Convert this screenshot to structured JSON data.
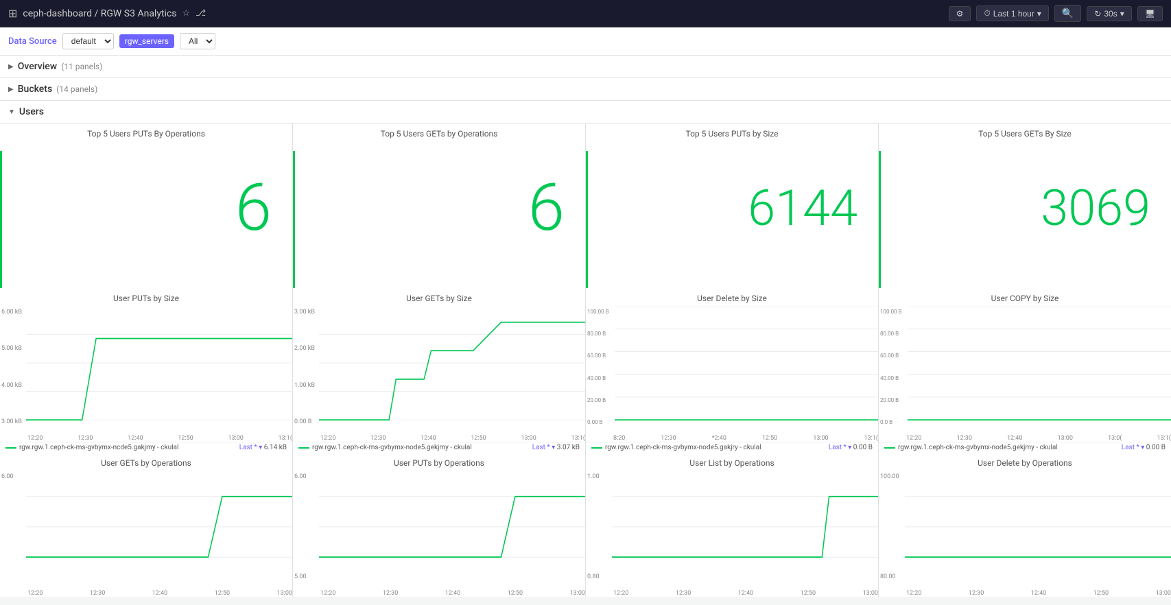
{
  "topbar": {
    "breadcrumb": "ceph-dashboard / RGW S3 Analytics",
    "settings_icon": "⚙",
    "clock_icon": "⏱",
    "time_range": "Last 1 hour",
    "zoom_icon": "🔍",
    "refresh_rate": "30s",
    "monitor_icon": "🖥"
  },
  "filterbar": {
    "label": "Data Source",
    "datasource_value": "default",
    "server_badge": "rgw_servers",
    "filter_value": "All"
  },
  "sections": [
    {
      "id": "overview",
      "label": "Overview",
      "count": "11 panels",
      "collapsed": true
    },
    {
      "id": "buckets",
      "label": "Buckets",
      "count": "14 panels",
      "collapsed": true
    },
    {
      "id": "users",
      "label": "Users",
      "collapsed": false
    }
  ],
  "stat_panels": [
    {
      "id": "top5-puts-ops",
      "title": "Top 5 Users PUTs By Operations",
      "value": "6"
    },
    {
      "id": "top5-gets-ops",
      "title": "Top 5 Users GETs by Operations",
      "value": "6"
    },
    {
      "id": "top5-puts-size",
      "title": "Top 5 Users PUTs by Size",
      "value": "6144"
    },
    {
      "id": "top5-gets-size",
      "title": "Top 5 Users GETs By Size",
      "value": "3069"
    }
  ],
  "chart_panels": [
    {
      "id": "user-puts-size",
      "title": "User PUTs by Size",
      "y_labels": [
        "6.00 kB",
        "5.00 kB",
        "4.00 kB",
        "3.00 kB"
      ],
      "x_labels": [
        "12:20",
        "12:30",
        "12:40",
        "12:50",
        "13:00",
        "13:1("
      ],
      "legend_text": "rgw.rgw.1.ceph-ck-ms-gvbymx-ncde5.gakjmy - ckulal",
      "legend_value": "6.14 kB",
      "last_label": "Last *"
    },
    {
      "id": "user-gets-size",
      "title": "User GETs by Size",
      "y_labels": [
        "3.00 kB",
        "2.00 kB",
        "1.00 kB",
        "0.00 B"
      ],
      "x_labels": [
        "12:20",
        "12:30",
        "12:40",
        "12:50",
        "13:00",
        "13:1("
      ],
      "legend_text": "rgw.rgw.1.ceph-ck-ms-gvbymx-node5.gekjmy - ckulal",
      "legend_value": "3.07 kB",
      "last_label": "Last *"
    },
    {
      "id": "user-delete-size",
      "title": "User Delete by Size",
      "y_labels": [
        "100.00 B",
        "80.00 B",
        "60.00 B",
        "40.00 B",
        "20.00 B",
        "0.00 B"
      ],
      "x_labels": [
        "8:20",
        "12:30",
        "*2:40",
        "12:50",
        "13:00",
        "13:1("
      ],
      "legend_text": "rgw.rgw.1.ceph-ck-ms-gvbymx-node5.gakjry - ckulal",
      "legend_value": "0.00 B",
      "last_label": "Last *"
    },
    {
      "id": "user-copy-size",
      "title": "User COPY by Size",
      "y_labels": [
        "100.00 B",
        "80.00 B",
        "60.00 B",
        "40.00 B",
        "20.00 B",
        "0.0 B"
      ],
      "x_labels": [
        "12:20",
        "12:30",
        "12:40",
        "13:00",
        "13:0(",
        "13:1("
      ],
      "legend_text": "rgw.rgw.1.ceph-ck-ms-gvbymx-node5.gekjmy - ckulal",
      "legend_value": "0.00 B",
      "last_label": "Last *"
    }
  ],
  "bottom_panels": [
    {
      "id": "user-gets-ops",
      "title": "User GETs by Operations",
      "y_labels": [
        "6.00",
        ""
      ],
      "x_labels": [
        "12:20",
        "12:30",
        "12:40",
        "12:50",
        "13:00"
      ]
    },
    {
      "id": "user-puts-ops",
      "title": "User PUTs by Operations",
      "y_labels": [
        "6.00",
        "5.00"
      ],
      "x_labels": [
        "12:20",
        "12:30",
        "12:40",
        "12:50",
        "13:00"
      ]
    },
    {
      "id": "user-list-ops",
      "title": "User List by Operations",
      "y_labels": [
        "1.00",
        "0.80"
      ],
      "x_labels": [
        "12:20",
        "12:30",
        "12:40",
        "12:50",
        "13:00"
      ]
    },
    {
      "id": "user-delete-ops",
      "title": "User Delete by Operations",
      "y_labels": [
        "100.00",
        "80.00"
      ],
      "x_labels": [
        "12:20",
        "12:30",
        "12:40",
        "12:50",
        "13:00"
      ]
    }
  ],
  "colors": {
    "accent": "#6c63ff",
    "green": "#00c853",
    "bg": "#f4f5f5",
    "border": "#e0e0e0",
    "topbar_bg": "#1a1a2e"
  }
}
